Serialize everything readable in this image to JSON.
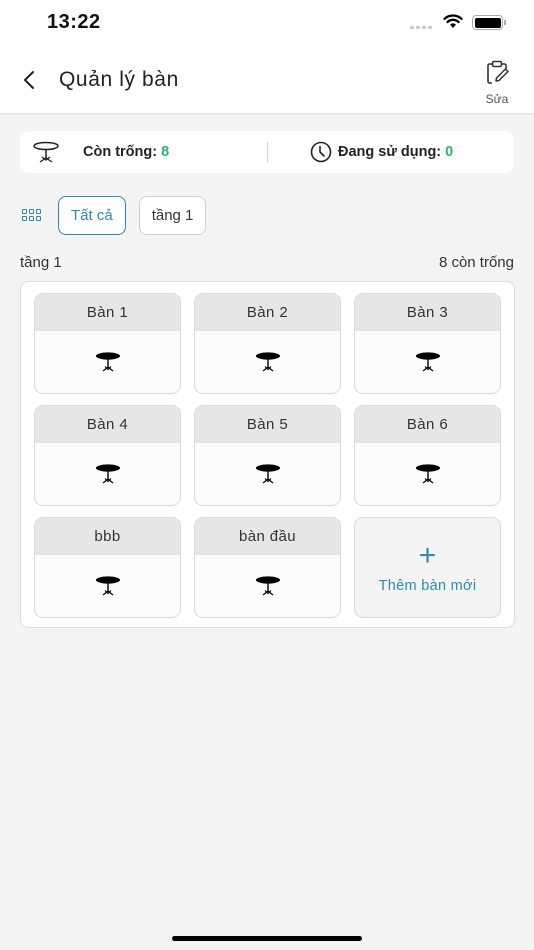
{
  "status_bar": {
    "time": "13:22"
  },
  "header": {
    "title": "Quản lý bàn",
    "edit_label": "Sửa"
  },
  "summary": {
    "available_label": "Còn trống:",
    "available_count": "8",
    "in_use_label": "Đang sử dụng:",
    "in_use_count": "0",
    "count_color": "#2fb36b"
  },
  "filters": {
    "chips": [
      {
        "label": "Tất cả",
        "active": true
      },
      {
        "label": "tầng 1",
        "active": false
      }
    ]
  },
  "floor": {
    "name": "tầng 1",
    "available_text": "8 còn trống",
    "tables": [
      {
        "name": "Bàn 1"
      },
      {
        "name": "Bàn 2"
      },
      {
        "name": "Bàn 3"
      },
      {
        "name": "Bàn 4"
      },
      {
        "name": "Bàn 5"
      },
      {
        "name": "Bàn 6"
      },
      {
        "name": "bbb"
      },
      {
        "name": "bàn đầu"
      }
    ],
    "add_label": "Thêm bàn mới",
    "add_symbol": "+"
  },
  "accent_color": "#2a8bb3"
}
